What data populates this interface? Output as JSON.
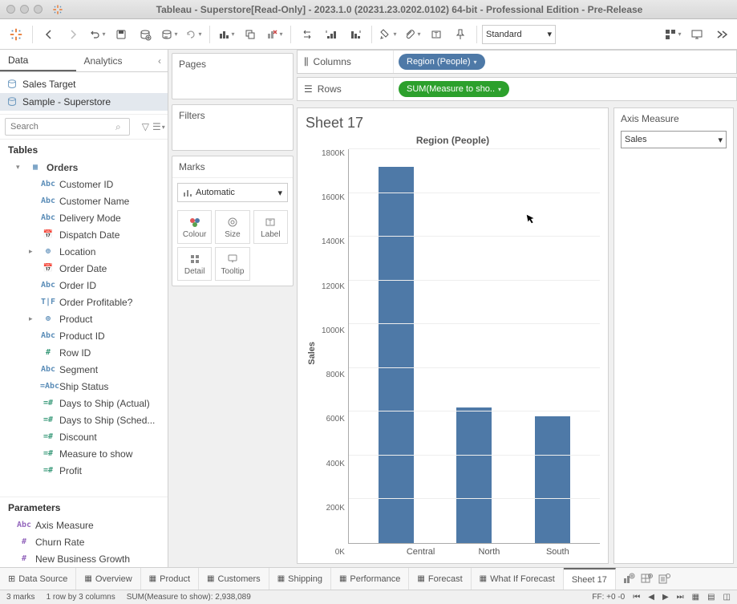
{
  "window": {
    "title": "Tableau - Superstore[Read-Only] - 2023.1.0 (20231.23.0202.0102) 64-bit - Professional Edition - Pre-Release"
  },
  "toolbar": {
    "fit_mode": "Standard"
  },
  "sidebar": {
    "tabs": {
      "data": "Data",
      "analytics": "Analytics"
    },
    "datasources": [
      {
        "name": "Sales Target",
        "active": false
      },
      {
        "name": "Sample - Superstore",
        "active": true
      }
    ],
    "search_placeholder": "Search",
    "tables_header": "Tables",
    "orders_group": "Orders",
    "fields": [
      {
        "icon": "Abc",
        "label": "Customer ID",
        "cls": ""
      },
      {
        "icon": "Abc",
        "label": "Customer Name",
        "cls": ""
      },
      {
        "icon": "Abc",
        "label": "Delivery Mode",
        "cls": ""
      },
      {
        "icon": "📅",
        "label": "Dispatch Date",
        "cls": ""
      },
      {
        "icon": "⊕",
        "label": "Location",
        "cls": "",
        "caret": true
      },
      {
        "icon": "📅",
        "label": "Order Date",
        "cls": ""
      },
      {
        "icon": "Abc",
        "label": "Order ID",
        "cls": ""
      },
      {
        "icon": "T|F",
        "label": "Order Profitable?",
        "cls": ""
      },
      {
        "icon": "⊕",
        "label": "Product",
        "cls": "",
        "caret": true
      },
      {
        "icon": "Abc",
        "label": "Product ID",
        "cls": ""
      },
      {
        "icon": "#",
        "label": "Row ID",
        "cls": "measure"
      },
      {
        "icon": "Abc",
        "label": "Segment",
        "cls": ""
      },
      {
        "icon": "=Abc",
        "label": "Ship Status",
        "cls": ""
      },
      {
        "icon": "=#",
        "label": "Days to Ship (Actual)",
        "cls": "calc"
      },
      {
        "icon": "=#",
        "label": "Days to Ship (Sched...",
        "cls": "calc"
      },
      {
        "icon": "=#",
        "label": "Discount",
        "cls": "calc"
      },
      {
        "icon": "=#",
        "label": "Measure to show",
        "cls": "calc"
      },
      {
        "icon": "=#",
        "label": "Profit",
        "cls": "calc"
      }
    ],
    "parameters_header": "Parameters",
    "parameters": [
      {
        "icon": "Abc",
        "label": "Axis Measure"
      },
      {
        "icon": "#",
        "label": "Churn Rate"
      },
      {
        "icon": "#",
        "label": "New Business Growth"
      }
    ]
  },
  "shelves": {
    "pages": "Pages",
    "filters": "Filters",
    "marks": "Marks",
    "marks_type": "Automatic",
    "mark_btns": {
      "colour": "Colour",
      "size": "Size",
      "label": "Label",
      "detail": "Detail",
      "tooltip": "Tooltip"
    }
  },
  "shelf_rows": {
    "columns_label": "Columns",
    "rows_label": "Rows",
    "columns_pill": "Region (People)",
    "rows_pill": "SUM(Measure to sho.."
  },
  "viz": {
    "sheet_title": "Sheet 17",
    "chart_title": "Region (People)",
    "y_axis_label": "Sales",
    "y_ticks": [
      "1800K",
      "1600K",
      "1400K",
      "1200K",
      "1000K",
      "800K",
      "600K",
      "400K",
      "200K",
      "0K"
    ],
    "x_labels": [
      "Central",
      "North",
      "South"
    ]
  },
  "chart_data": {
    "type": "bar",
    "title": "Region (People)",
    "xlabel": "",
    "ylabel": "Sales",
    "ylim": [
      0,
      1800000
    ],
    "categories": [
      "Central",
      "North",
      "South"
    ],
    "values": [
      1720000,
      620000,
      580000
    ]
  },
  "right_panel": {
    "title": "Axis Measure",
    "value": "Sales"
  },
  "bottom_tabs": {
    "data_source": "Data Source",
    "tabs": [
      "Overview",
      "Product",
      "Customers",
      "Shipping",
      "Performance",
      "Forecast",
      "What If Forecast",
      "Sheet 17"
    ],
    "active": "Sheet 17"
  },
  "statusbar": {
    "marks": "3 marks",
    "rows_cols": "1 row by 3 columns",
    "agg": "SUM(Measure to show): 2,938,089",
    "ff": "FF: +0 -0"
  }
}
